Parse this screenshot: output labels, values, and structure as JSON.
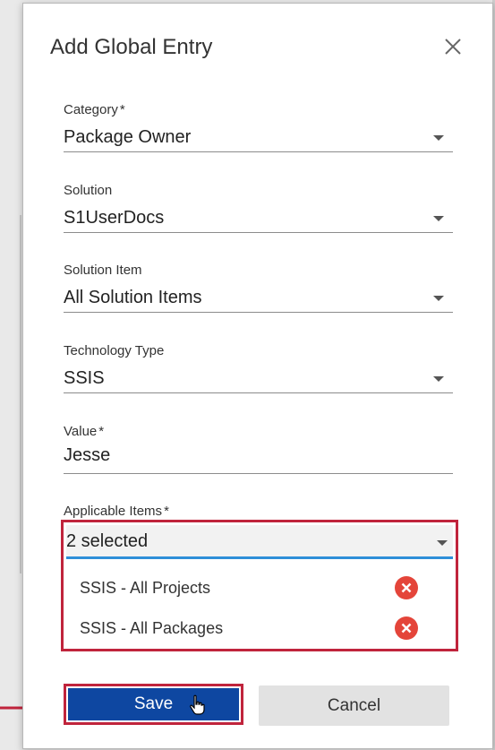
{
  "dialog": {
    "title": "Add Global Entry",
    "close_icon": "close-icon"
  },
  "fields": {
    "category": {
      "label": "Category",
      "required": "*",
      "value": "Package Owner"
    },
    "solution": {
      "label": "Solution",
      "value": "S1UserDocs"
    },
    "solution_item": {
      "label": "Solution Item",
      "value": "All Solution Items"
    },
    "technology_type": {
      "label": "Technology Type",
      "value": "SSIS"
    },
    "value": {
      "label": "Value",
      "required": "*",
      "value": "Jesse"
    },
    "applicable_items": {
      "label": "Applicable Items",
      "required": "*",
      "value": "2 selected",
      "items": [
        {
          "label": "SSIS - All Projects"
        },
        {
          "label": "SSIS - All Packages"
        }
      ]
    }
  },
  "buttons": {
    "save": "Save",
    "cancel": "Cancel"
  },
  "colors": {
    "accent_blue": "#0e47a1",
    "focus_underline": "#2f8fd8",
    "highlight_red": "#c0243c",
    "remove_red": "#e4453a"
  }
}
